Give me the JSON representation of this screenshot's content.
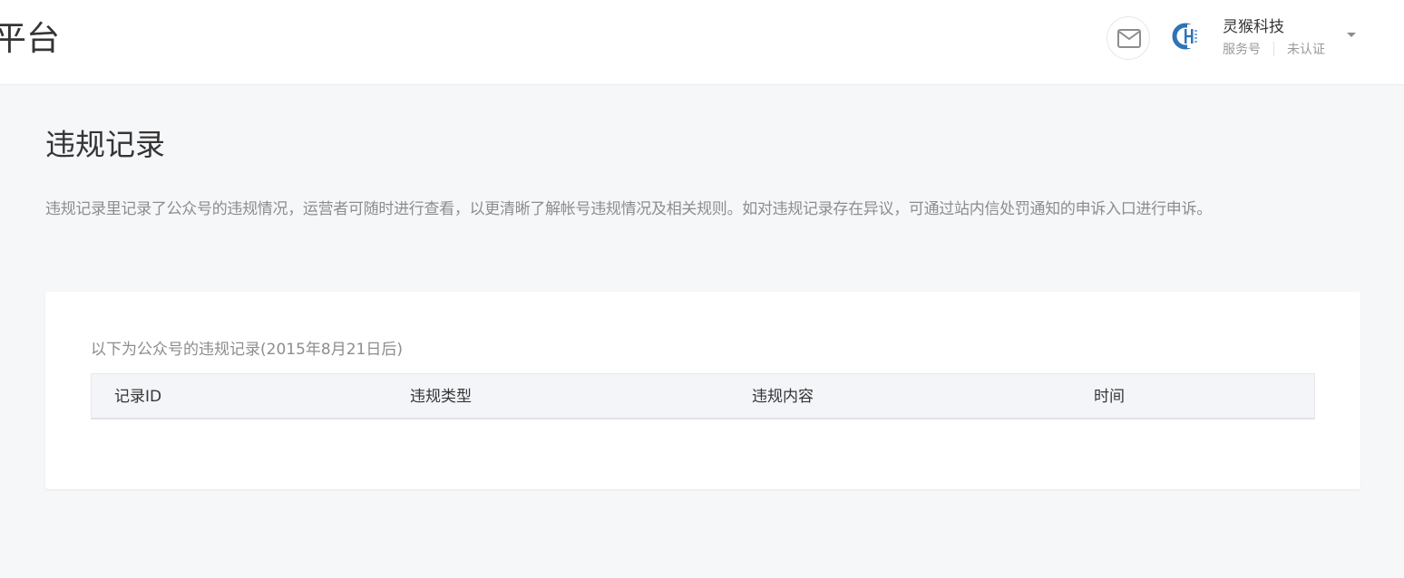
{
  "header": {
    "platform_title": "平台",
    "account": {
      "name": "灵猴科技",
      "type": "服务号",
      "verification": "未认证"
    },
    "icons": {
      "mail": "mail-icon",
      "dropdown": "caret-down-icon",
      "avatar": "account-avatar"
    }
  },
  "page": {
    "title": "违规记录",
    "description": "违规记录里记录了公众号的违规情况，运营者可随时进行查看，以更清晰了解帐号违规情况及相关规则。如对违规记录存在异议，可通过站内信处罚通知的申诉入口进行申诉。"
  },
  "records": {
    "caption": "以下为公众号的违规记录(2015年8月21日后)",
    "columns": [
      "记录ID",
      "违规类型",
      "违规内容",
      "时间"
    ],
    "rows": []
  },
  "colors": {
    "background": "#f6f7f9",
    "card": "#ffffff",
    "table_header": "#f4f5f9",
    "text_primary": "#353535",
    "text_secondary": "#8d8d8d",
    "avatar_blue": "#2f74b5"
  }
}
